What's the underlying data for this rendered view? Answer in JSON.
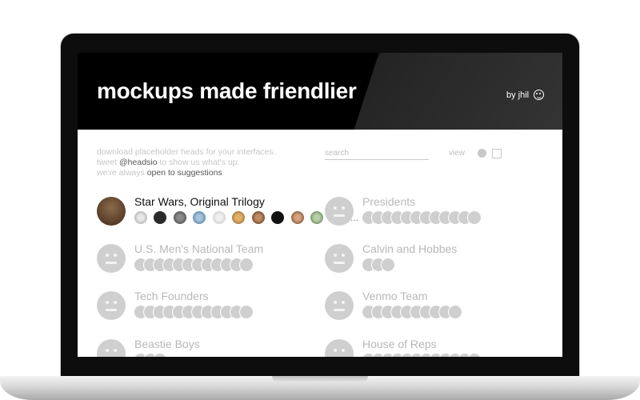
{
  "header": {
    "title": "mockups made friendlier",
    "byline": "by jhil"
  },
  "intro": {
    "line1": "download placeholder heads for your interfaces.",
    "line2_prefix": "tweet ",
    "line2_handle": "@headsio",
    "line2_suffix": " to show us what's up.",
    "line3_prefix": "we're always ",
    "line3_link": "open to suggestions",
    "line3_suffix": "."
  },
  "search": {
    "placeholder": "search"
  },
  "view": {
    "label": "view"
  },
  "collections": [
    {
      "title": "Star Wars, Original Trilogy",
      "active": true,
      "count": 11,
      "more": "..."
    },
    {
      "title": "Presidents",
      "active": false,
      "count": 12
    },
    {
      "title": "U.S. Men's National Team",
      "active": false,
      "count": 12
    },
    {
      "title": "Calvin and Hobbes",
      "active": false,
      "count": 3
    },
    {
      "title": "Tech Founders",
      "active": false,
      "count": 12
    },
    {
      "title": "Venmo Team",
      "active": false,
      "count": 10
    },
    {
      "title": "Beastie Boys",
      "active": false,
      "count": 3
    },
    {
      "title": "House of Reps",
      "active": false,
      "count": 12
    }
  ],
  "colors": {
    "header_bg": "#000000",
    "placeholder_gray": "#cfcfcf",
    "muted_text": "#b8b8b8"
  }
}
